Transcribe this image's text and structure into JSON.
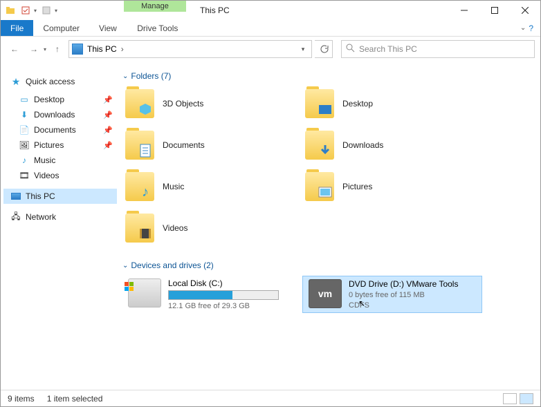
{
  "title": "This PC",
  "ribbon": {
    "ctx_label": "Manage",
    "ctx_tab": "Drive Tools",
    "file": "File",
    "tabs": [
      "Computer",
      "View"
    ]
  },
  "address": {
    "text": "This PC",
    "crumb_arrow": "›"
  },
  "search": {
    "placeholder": "Search This PC"
  },
  "sidebar": {
    "quick": "Quick access",
    "items": [
      {
        "label": "Desktop",
        "pin": true
      },
      {
        "label": "Downloads",
        "pin": true
      },
      {
        "label": "Documents",
        "pin": true
      },
      {
        "label": "Pictures",
        "pin": true
      },
      {
        "label": "Music",
        "pin": false
      },
      {
        "label": "Videos",
        "pin": false
      }
    ],
    "thispc": "This PC",
    "network": "Network"
  },
  "groups": {
    "folders": {
      "title": "Folders (7)"
    },
    "drives": {
      "title": "Devices and drives (2)"
    }
  },
  "folders": [
    {
      "label": "3D Objects"
    },
    {
      "label": "Desktop"
    },
    {
      "label": "Documents"
    },
    {
      "label": "Downloads"
    },
    {
      "label": "Music"
    },
    {
      "label": "Pictures"
    },
    {
      "label": "Videos"
    }
  ],
  "drives_list": [
    {
      "label": "Local Disk (C:)",
      "sub": "12.1 GB free of 29.3 GB",
      "fill_pct": 58
    },
    {
      "label": "DVD Drive (D:) VMware Tools",
      "sub": "0 bytes free of 115 MB",
      "fs": "CDFS",
      "selected": true
    }
  ],
  "status": {
    "count": "9 items",
    "selection": "1 item selected"
  }
}
